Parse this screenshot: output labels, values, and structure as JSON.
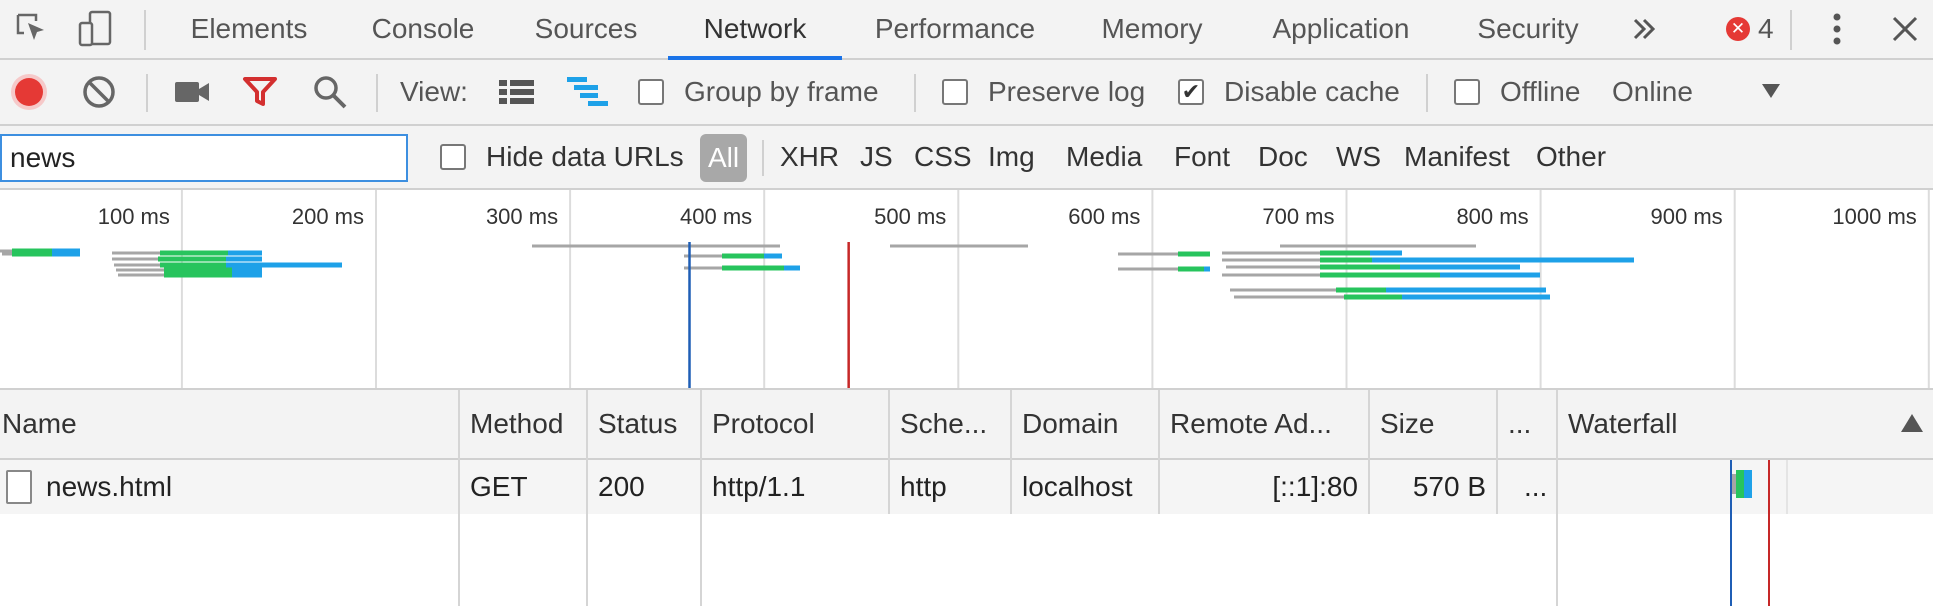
{
  "tabs": [
    {
      "label": "Elements"
    },
    {
      "label": "Console"
    },
    {
      "label": "Sources"
    },
    {
      "label": "Network",
      "active": true
    },
    {
      "label": "Performance"
    },
    {
      "label": "Memory"
    },
    {
      "label": "Application"
    },
    {
      "label": "Security"
    }
  ],
  "tabbar": {
    "more_icon": "double-chevron-right-icon",
    "error_count": "4",
    "error_icon": "error-circle-icon",
    "menu_icon": "kebab-menu-icon",
    "close_icon": "close-icon"
  },
  "toolbar": {
    "record_icon": "record-icon",
    "clear_icon": "clear-icon",
    "capture_icon": "video-camera-icon",
    "filter_icon": "filter-icon",
    "search_icon": "search-icon",
    "view_label": "View:",
    "group_by_frame": {
      "label": "Group by frame",
      "checked": false
    },
    "preserve_log": {
      "label": "Preserve log",
      "checked": false
    },
    "disable_cache": {
      "label": "Disable cache",
      "checked": true
    },
    "offline": {
      "label": "Offline",
      "checked": false
    },
    "throttling": "Online"
  },
  "filter": {
    "value": "news",
    "hide_data_urls": {
      "label": "Hide data URLs",
      "checked": false
    },
    "types": [
      "All",
      "XHR",
      "JS",
      "CSS",
      "Img",
      "Media",
      "Font",
      "Doc",
      "WS",
      "Manifest",
      "Other"
    ],
    "active_type": "All"
  },
  "overview": {
    "ticks": [
      "100 ms",
      "200 ms",
      "300 ms",
      "400 ms",
      "500 ms",
      "600 ms",
      "700 ms",
      "800 ms",
      "900 ms",
      "1000 ms"
    ],
    "dom_content_loaded_ms": 361,
    "load_ms": 443,
    "colors": {
      "waiting": "#a6a6a6",
      "ttfb": "#27c45d",
      "download": "#1ea1e8",
      "dcl": "#1f5eb5",
      "load": "#c62828"
    }
  },
  "columns": [
    "Name",
    "Method",
    "Status",
    "Protocol",
    "Sche...",
    "Domain",
    "Remote Ad...",
    "Size",
    "...",
    "Waterfall"
  ],
  "requests": [
    {
      "name": "news.html",
      "method": "GET",
      "status": "200",
      "protocol": "http/1.1",
      "scheme": "http",
      "domain": "localhost",
      "remote_address": "[::1]:80",
      "size": "570 B",
      "more": "..."
    }
  ]
}
